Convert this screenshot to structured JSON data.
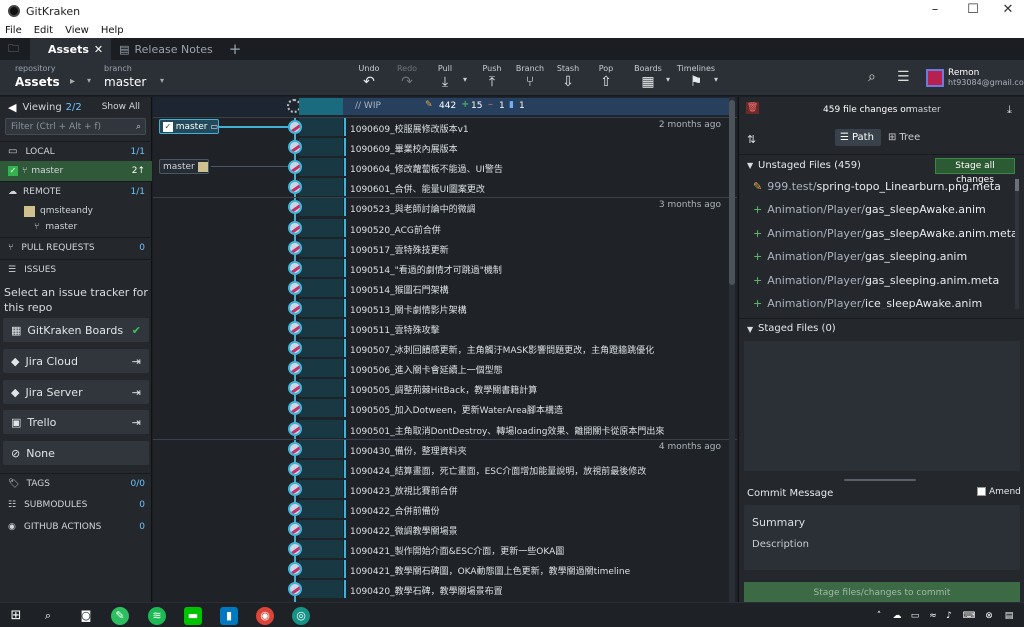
{
  "window": {
    "title": "GitKraken"
  },
  "menu": [
    "File",
    "Edit",
    "View",
    "Help"
  ],
  "tabs": [
    {
      "label": "Assets"
    },
    {
      "label": "Release Notes"
    }
  ],
  "toolbar": {
    "repo_label": "repository",
    "repo_value": "Assets",
    "branch_label": "branch",
    "branch_value": "master",
    "buttons": [
      "Undo",
      "Redo",
      "Pull",
      "Push",
      "Branch",
      "Stash",
      "Pop",
      "Boards",
      "Timelines"
    ],
    "user_name": "Remon",
    "user_email": "ht93084@gmail.com"
  },
  "left": {
    "viewing": "Viewing",
    "viewing_count": "2/2",
    "show_all": "Show All",
    "filter_placeholder": "Filter (Ctrl + Alt + f)",
    "local": "LOCAL",
    "local_count": "1/1",
    "master": "master",
    "master_count": "2↑",
    "remote": "REMOTE",
    "remote_count": "1/1",
    "remote_name": "qmsiteandy",
    "remote_branch": "master",
    "pull_requests": "PULL REQUESTS",
    "pull_count": "0",
    "issues": "ISSUES",
    "issue_prompt": "Select an issue tracker for this repo",
    "trackers": [
      "GitKraken Boards",
      "Jira Cloud",
      "Jira Server",
      "Trello",
      "None"
    ],
    "tags": "TAGS",
    "tags_count": "0/0",
    "submodules": "SUBMODULES",
    "submodules_count": "0",
    "actions": "GITHUB ACTIONS",
    "actions_count": "0"
  },
  "graph": {
    "wip": "// WIP",
    "wip_stats": [
      "442",
      "15",
      "1",
      "1"
    ],
    "branch_local": "master",
    "branch_remote": "master",
    "commits": [
      {
        "msg": "1090609_校服展修改版本v1",
        "when": "2 months ago"
      },
      {
        "msg": "1090609_畢業校內展版本",
        "when": ""
      },
      {
        "msg": "1090604_修改蘿蔔板不能過、UI警告",
        "when": ""
      },
      {
        "msg": "1090601_合併、能量UI圖案更改",
        "when": ""
      },
      {
        "msg": "1090523_與老師討論中的微調",
        "when": "3 months ago"
      },
      {
        "msg": "1090520_ACG前合併",
        "when": ""
      },
      {
        "msg": "1090517_雲特殊技更新",
        "when": ""
      },
      {
        "msg": "1090514_\"看過的劇情才可跳過\"機制",
        "when": ""
      },
      {
        "msg": "1090514_猴圖石門架構",
        "when": ""
      },
      {
        "msg": "1090513_關卡劇情影片架構",
        "when": ""
      },
      {
        "msg": "1090511_雲特殊攻擊",
        "when": ""
      },
      {
        "msg": "1090507_冰刺回饋感更新，主角觸汙MASK影響問題更改，主角蹬牆跳優化",
        "when": ""
      },
      {
        "msg": "1090506_進入關卡會延續上一個型態",
        "when": ""
      },
      {
        "msg": "1090505_調整荊棘HitBack，教學關書籍計算",
        "when": ""
      },
      {
        "msg": "1090505_加入Dotween，更新WaterArea腳本構造",
        "when": ""
      },
      {
        "msg": "1090501_主角取消DontDestroy、轉場loading效果、離開關卡從原本門出來",
        "when": ""
      },
      {
        "msg": "1090430_備份，整理資料夾",
        "when": "4 months ago"
      },
      {
        "msg": "1090424_結算畫面，死亡畫面，ESC介面增加能量說明，放視前最後修改",
        "when": ""
      },
      {
        "msg": "1090423_放視比賽前合併",
        "when": ""
      },
      {
        "msg": "1090422_合併前備份",
        "when": ""
      },
      {
        "msg": "1090422_微調教學關場景",
        "when": ""
      },
      {
        "msg": "1090421_製作開始介面&ESC介面，更新一些OKA圖",
        "when": ""
      },
      {
        "msg": "1090421_教學關石碑圖，OKA動態圖上色更新，教學關過關timeline",
        "when": ""
      },
      {
        "msg": "1090420_教學石碑，教學關場景布置",
        "when": ""
      }
    ]
  },
  "right": {
    "changes": "459 file changes on",
    "branch": "master",
    "path": "Path",
    "tree": "Tree",
    "unstaged": "Unstaged Files (459)",
    "stage_all": "Stage all changes",
    "files": [
      {
        "dir": "999.test/",
        "name": "spring-topo_Linearburn.png.meta",
        "mod": true
      },
      {
        "dir": "Animation/Player/",
        "name": "gas_sleepAwake.anim",
        "mod": false
      },
      {
        "dir": "Animation/Player/",
        "name": "gas_sleepAwake.anim.meta",
        "mod": false
      },
      {
        "dir": "Animation/Player/",
        "name": "gas_sleeping.anim",
        "mod": false
      },
      {
        "dir": "Animation/Player/",
        "name": "gas_sleeping.anim.meta",
        "mod": false
      },
      {
        "dir": "Animation/Player/",
        "name": "ice_sleepAwake.anim",
        "mod": false
      }
    ],
    "staged": "Staged Files (0)",
    "commit_message": "Commit Message",
    "amend": "Amend",
    "summary": "Summary",
    "description": "Description",
    "commit_btn": "Stage files/changes to commit"
  },
  "taskbar": {
    "time": "",
    "icons": [
      "windows-logo",
      "search",
      "camera",
      "evernote",
      "spotify",
      "line",
      "trello",
      "chrome",
      "gitkraken"
    ]
  }
}
